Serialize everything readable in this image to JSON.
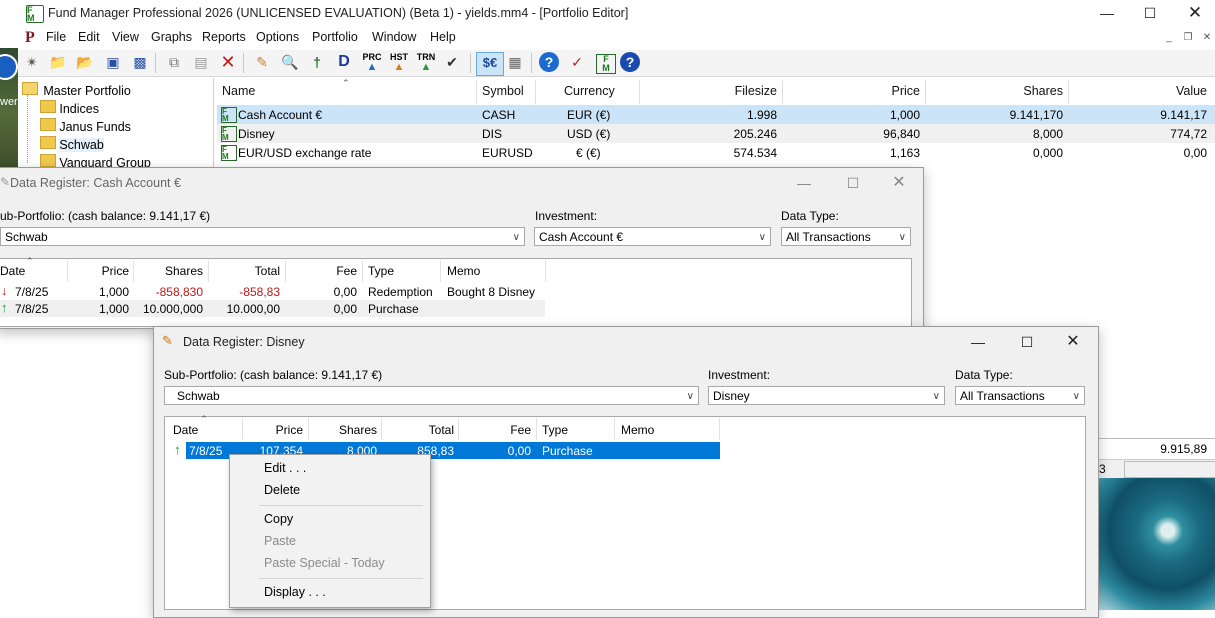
{
  "app": {
    "title": "Fund Manager Professional 2026 (UNLICENSED EVALUATION) (Beta 1) - yields.mm4 - [Portfolio Editor]",
    "icon_name": "fm-logo-icon",
    "accent": "#0078d7"
  },
  "menu": [
    "File",
    "Edit",
    "View",
    "Graphs",
    "Reports",
    "Options",
    "Portfolio",
    "Window",
    "Help"
  ],
  "desktop_label": "wer",
  "toolbar": {
    "text_buttons": {
      "prc": "PRC",
      "hst": "HST",
      "trn": "TRN"
    },
    "icons": [
      "new-icon",
      "open-icon",
      "open2-icon",
      "save-icon",
      "save-all-icon",
      "copy-icon",
      "paste-icon",
      "delete-icon",
      "edit-icon",
      "find-icon",
      "split-icon",
      "dividend-icon",
      "prc-icon",
      "hst-icon",
      "trn-icon",
      "check-icon",
      "currency-icon",
      "calculator-icon",
      "help-icon",
      "check-mark-icon",
      "fm-icon",
      "info-icon"
    ]
  },
  "tree": {
    "items": [
      "Master Portfolio",
      "Indices",
      "Janus Funds",
      "Schwab",
      "Vanguard Group"
    ]
  },
  "portfolio_grid": {
    "columns": [
      "Name",
      "Symbol",
      "Currency",
      "Filesize",
      "Price",
      "Shares",
      "Value"
    ],
    "rows": [
      {
        "name": "Cash Account €",
        "symbol": "CASH",
        "currency": "EUR (€)",
        "filesize": "1.998",
        "price": "1,000",
        "shares": "9.141,170",
        "value": "9.141,17"
      },
      {
        "name": "Disney",
        "symbol": "DIS",
        "currency": "USD (€)",
        "filesize": "205.246",
        "price": "96,840",
        "shares": "8,000",
        "value": "774,72"
      },
      {
        "name": "EUR/USD exchange rate",
        "symbol": "EURUSD",
        "currency": "€ (€)",
        "filesize": "574.534",
        "price": "1,163",
        "shares": "0,000",
        "value": "0,00"
      }
    ],
    "total_value": "9.915,89",
    "footer_cell": "3"
  },
  "register_cash": {
    "title": "Data Register: Cash Account €",
    "subportfolio_label": "ub-Portfolio: (cash balance: 9.141,17 €)",
    "subportfolio_value": "Schwab",
    "investment_label": "Investment:",
    "investment_value": "Cash Account €",
    "datatype_label": "Data Type:",
    "datatype_value": "All Transactions",
    "columns": [
      "Date",
      "Price",
      "Shares",
      "Total",
      "Fee",
      "Type",
      "Memo"
    ],
    "rows": [
      {
        "date": "7/8/25",
        "price": "1,000",
        "shares": "-858,830",
        "total": "-858,83",
        "fee": "0,00",
        "type": "Redemption",
        "memo": "Bought 8 Disney"
      },
      {
        "date": "7/8/25",
        "price": "1,000",
        "shares": "10.000,000",
        "total": "10.000,00",
        "fee": "0,00",
        "type": "Purchase",
        "memo": ""
      }
    ]
  },
  "register_disney": {
    "title": "Data Register: Disney",
    "subportfolio_label": "Sub-Portfolio: (cash balance: 9.141,17 €)",
    "subportfolio_value": "Schwab",
    "investment_label": "Investment:",
    "investment_value": "Disney",
    "datatype_label": "Data Type:",
    "datatype_value": "All Transactions",
    "columns": [
      "Date",
      "Price",
      "Shares",
      "Total",
      "Fee",
      "Type",
      "Memo"
    ],
    "rows": [
      {
        "date": "7/8/25",
        "price": "107,354",
        "shares": "8,000",
        "total": "858,83",
        "fee": "0,00",
        "type": "Purchase",
        "memo": ""
      }
    ]
  },
  "context_menu": {
    "edit": "Edit . . .",
    "delete": "Delete",
    "copy": "Copy",
    "paste": "Paste",
    "paste_special": "Paste Special - Today",
    "display": "Display . . ."
  }
}
